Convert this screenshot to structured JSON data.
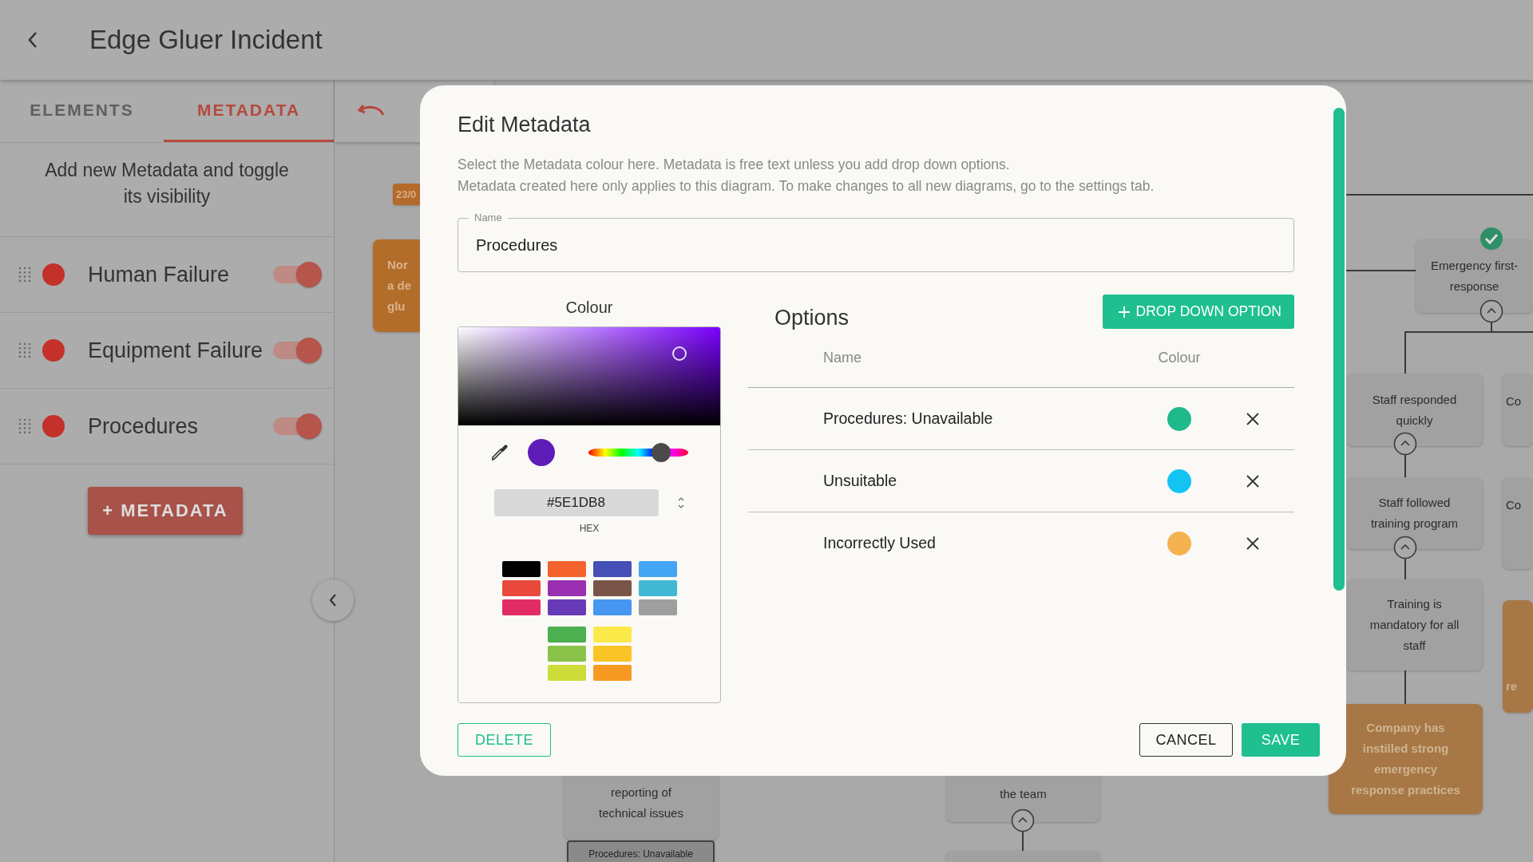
{
  "header": {
    "title": "Edge Gluer Incident"
  },
  "sidebar": {
    "tabs": [
      {
        "label": "ELEMENTS",
        "selected": false
      },
      {
        "label": "METADATA",
        "selected": true
      }
    ],
    "hint": "Add new Metadata and toggle its visibility",
    "metadata": [
      {
        "name": "Human Failure",
        "color": "#c4302a",
        "on": true
      },
      {
        "name": "Equipment Failure",
        "color": "#c4302a",
        "on": true
      },
      {
        "name": "Procedures",
        "color": "#c4302a",
        "on": true
      }
    ],
    "add_button": "+ METADATA"
  },
  "canvas": {
    "nodes": [
      {
        "kind": "tag",
        "lines": [
          "23/0"
        ]
      },
      {
        "kind": "orange",
        "lines": [
          "Nor",
          "a de",
          "glu"
        ]
      },
      {
        "kind": "grey",
        "lines": [
          "Emergency first-",
          "response"
        ],
        "checked": true
      },
      {
        "kind": "grey",
        "lines": [
          "Staff responded",
          "quickly"
        ]
      },
      {
        "kind": "grey",
        "lines": [
          "Co"
        ]
      },
      {
        "kind": "grey",
        "lines": [
          "Staff followed",
          "training program"
        ]
      },
      {
        "kind": "grey",
        "lines": [
          "Co"
        ]
      },
      {
        "kind": "grey",
        "lines": [
          "Training is",
          "mandatory for all",
          "staff"
        ]
      },
      {
        "kind": "orange",
        "lines": [
          "re"
        ]
      },
      {
        "kind": "orange",
        "lines": [
          "Company has",
          "instilled strong",
          "emergency",
          "response practices"
        ]
      },
      {
        "kind": "grey",
        "lines": [
          "reporting of",
          "technical issues"
        ]
      },
      {
        "kind": "label",
        "lines": [
          "Procedures: Unavailable"
        ]
      },
      {
        "kind": "grey",
        "lines": [
          "the team"
        ]
      },
      {
        "kind": "grey"
      }
    ]
  },
  "modal": {
    "title": "Edit Metadata",
    "description": [
      "Select the Metadata colour here. Metadata is free text unless you add drop down options.",
      "Metadata created here only applies to this diagram. To make changes to all new diagrams, go to the settings tab."
    ],
    "name_field": {
      "label": "Name",
      "value": "Procedures"
    },
    "colour": {
      "label": "Colour",
      "hex": "#5E1DB8",
      "hex_label": "HEX",
      "hue": {
        "level": 0.73
      },
      "swatch_groups": [
        [
          {
            "color": "#000000"
          },
          {
            "color": "#f4622d"
          },
          {
            "color": "#4450b5"
          },
          {
            "color": "#44a6f2"
          },
          {
            "color": "#e9493b"
          },
          {
            "color": "#9a2fb1"
          },
          {
            "color": "#785548"
          },
          {
            "color": "#41b8d3"
          },
          {
            "color": "#e22c66"
          },
          {
            "color": "#673bb7"
          },
          {
            "color": "#4696f2"
          },
          {
            "color": "#9e9e9e"
          }
        ],
        [
          {
            "color": "#4caf50"
          },
          {
            "color": "#fbe94a"
          },
          {
            "color": "#8bc34a"
          },
          {
            "color": "#f9c526"
          },
          {
            "color": "#cddc39"
          },
          {
            "color": "#f79a23"
          }
        ]
      ]
    },
    "options": {
      "title": "Options",
      "add_button": "DROP DOWN OPTION",
      "columns": [
        "Name",
        "Colour"
      ],
      "rows": [
        {
          "name": "Procedures: Unavailable",
          "color": "#1fb98b"
        },
        {
          "name": "Unsuitable",
          "color": "#13c4f3"
        },
        {
          "name": "Incorrectly Used",
          "color": "#f4b350"
        }
      ]
    },
    "buttons": {
      "delete": "DELETE",
      "cancel": "CANCEL",
      "save": "SAVE"
    }
  }
}
